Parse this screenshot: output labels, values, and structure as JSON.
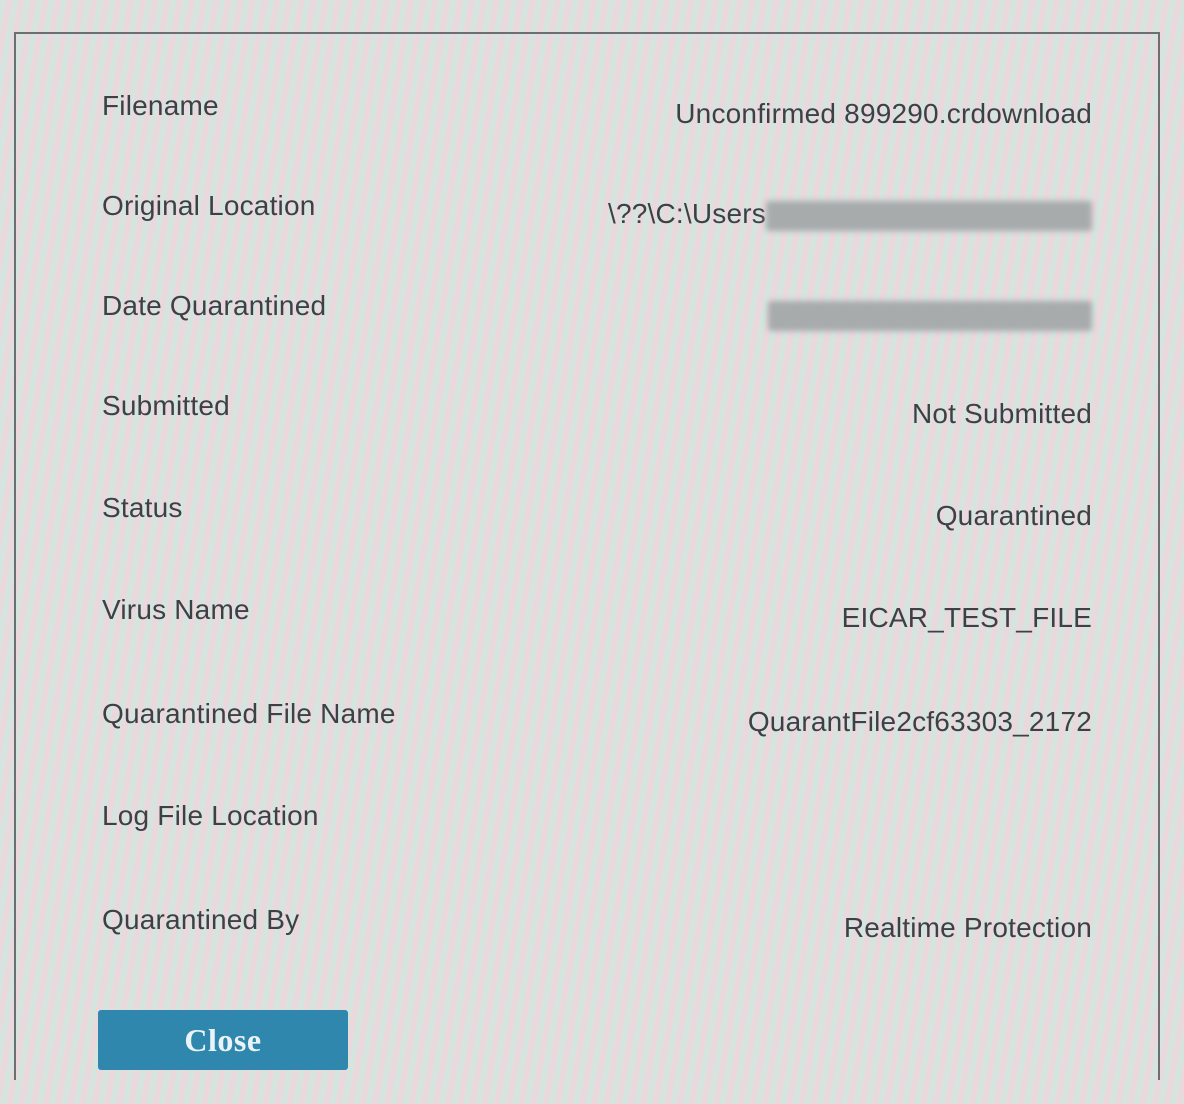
{
  "fields": [
    {
      "label": "Filename",
      "value": "Unconfirmed 899290.crdownload"
    },
    {
      "label": "Original Location",
      "value": "\\??\\C:\\Users",
      "redacted_suffix": true
    },
    {
      "label": "Date Quarantined",
      "value": "",
      "redacted_suffix": true
    },
    {
      "label": "Submitted",
      "value": "Not Submitted"
    },
    {
      "label": "Status",
      "value": "Quarantined"
    },
    {
      "label": "Virus Name",
      "value": "EICAR_TEST_FILE"
    },
    {
      "label": "Quarantined File Name",
      "value": "QuarantFile2cf63303_2172"
    },
    {
      "label": "Log File Location",
      "value": ""
    },
    {
      "label": "Quarantined By",
      "value": "Realtime Protection"
    }
  ],
  "actions": {
    "close_label": "Close"
  },
  "colors": {
    "button": "#2f87ad",
    "text": "#3d4145",
    "border": "#6a6f72"
  }
}
